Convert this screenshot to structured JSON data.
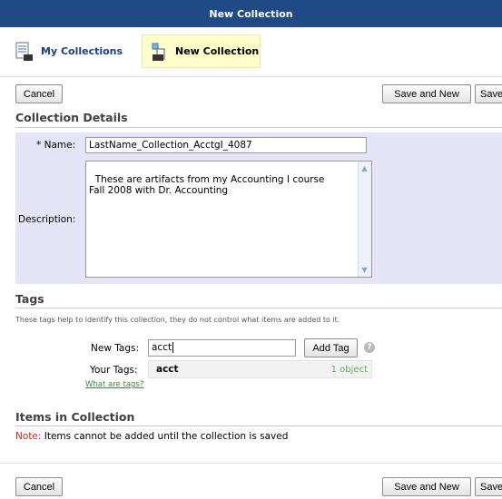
{
  "window": {
    "title": "New Collection"
  },
  "nav": {
    "my_collections": "My Collections",
    "new_collection": "New Collection"
  },
  "toolbar": {
    "cancel": "Cancel",
    "save_and_new": "Save and New",
    "save": "Save"
  },
  "details": {
    "heading": "Collection Details",
    "name_label": "* Name:",
    "name_value": "LastName_Collection_AcctgI_4087",
    "description_label": "Description:",
    "description_value": "These are artifacts from my Accounting I course\nFall 2008 with Dr. Accounting"
  },
  "tags": {
    "heading": "Tags",
    "help": "These tags help to identify this collection, they do not control what items are added to it.",
    "new_tags_label": "New Tags:",
    "new_tags_value": "acct",
    "add_tag_button": "Add Tag",
    "your_tags_label": "Your Tags:",
    "existing": [
      {
        "name": "acct",
        "count": "1 object"
      }
    ],
    "what_are_tags": "What are tags?"
  },
  "items": {
    "heading": "Items in Collection",
    "note_label": "Note:",
    "note_text": " Items cannot be added until the collection is saved"
  },
  "colors": {
    "titlebar": "#1f4a86",
    "accent_note": "#e02020",
    "link": "#3b8a3b"
  }
}
